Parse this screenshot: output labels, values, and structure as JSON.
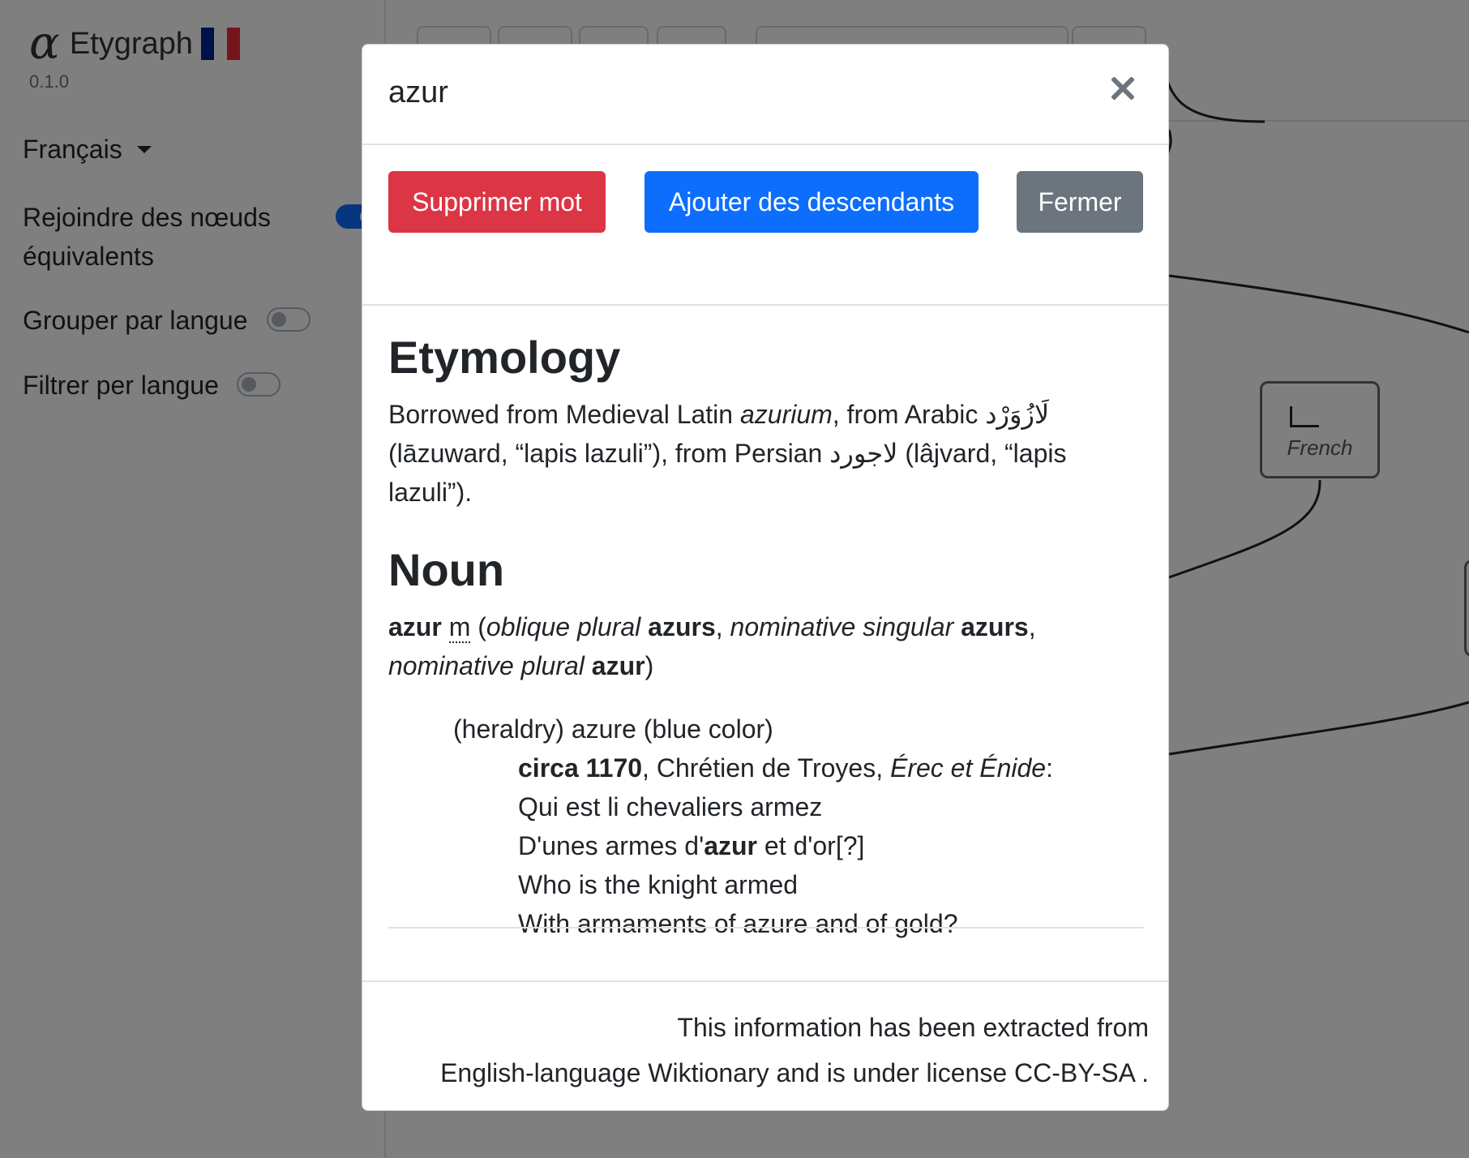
{
  "app": {
    "name": "Etygraph",
    "logo_glyph": "α",
    "version": "0.1.0",
    "flag_colors": [
      "#002395",
      "#ffffff",
      "#ED2939"
    ]
  },
  "sidebar": {
    "language_select": "Français",
    "options": [
      {
        "label_line1": "Rejoindre des nœuds",
        "label_line2": "équivalents",
        "on": true
      },
      {
        "label": "Grouper par langue",
        "on": false
      },
      {
        "label": "Filtrer per langue",
        "on": false
      }
    ]
  },
  "graph": {
    "node_label": "French"
  },
  "modal": {
    "title": "azur",
    "buttons": {
      "delete": "Supprimer mot",
      "add_descendants": "Ajouter des descendants",
      "close": "Fermer"
    },
    "etymology": {
      "heading": "Etymology",
      "t1": "Borrowed from Medieval Latin ",
      "latin_word": "azurium",
      "t2": ", from Arabic ",
      "arabic_word": "لَازُوَرْد",
      "t3": " (lāzuward, “lapis lazuli”), from Persian ",
      "persian_word": "لاجورد",
      "t4": " (lâjvard, “lapis lazuli”)."
    },
    "noun": {
      "heading": "Noun",
      "headword": "azur",
      "gender": "m",
      "open_paren": " (",
      "label1": "oblique plural",
      "form1": "azurs",
      "label2": "nominative singular",
      "form2": "azurs",
      "label3": "nominative plural",
      "form3": "azur",
      "close_paren": ")"
    },
    "sense": {
      "definition": "(heraldry) azure (blue color)",
      "date": "circa 1170",
      "author": ", Chrétien de Troyes, ",
      "work": "Érec et Énide",
      "colon": ":",
      "quote_line1": "Qui est li chevaliers armez",
      "quote_line2_a": "D'unes armes d'",
      "quote_line2_b": "azur",
      "quote_line2_c": " et d'or[?]",
      "translation_line1": "Who is the knight armed",
      "translation_line2": "With armaments of azure and of gold?"
    },
    "footer": {
      "line1": "This information has been extracted from",
      "line2": "English-language Wiktionary and is under license CC-BY-SA ."
    }
  }
}
